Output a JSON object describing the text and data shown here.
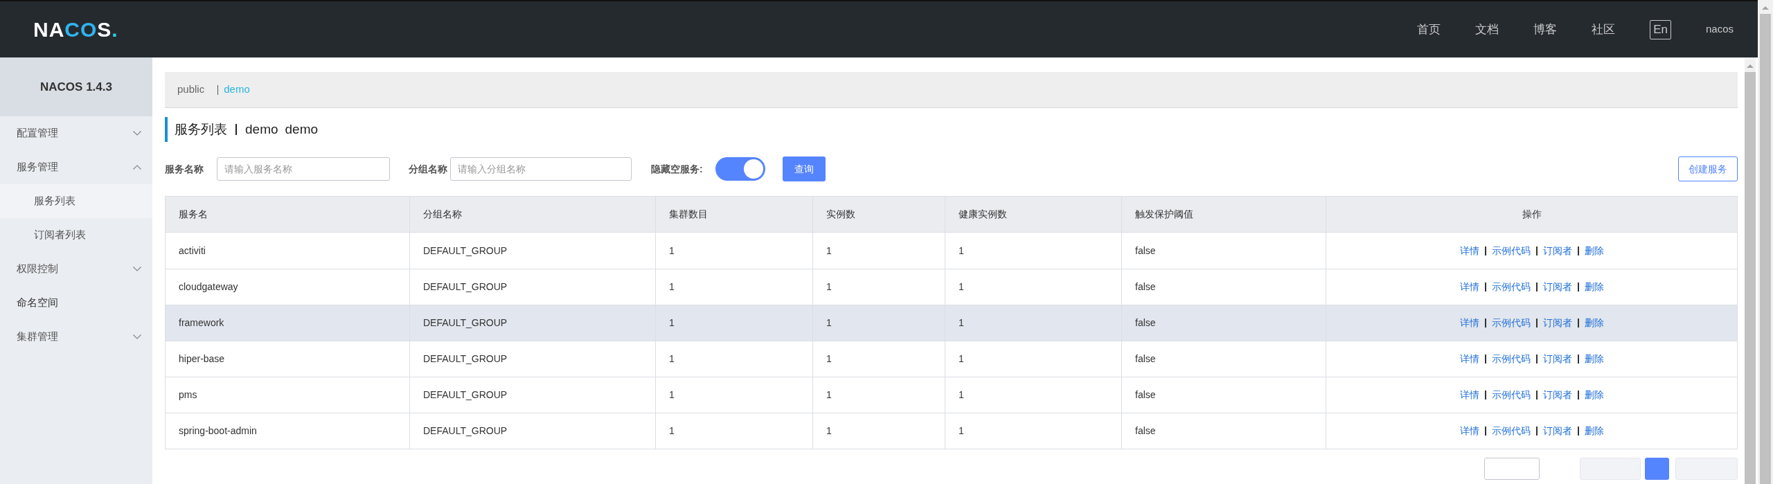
{
  "header": {
    "logo": "NACOS.",
    "nav": [
      "首页",
      "文档",
      "博客",
      "社区"
    ],
    "language": "En",
    "user": "nacos"
  },
  "sidebar": {
    "title": "NACOS 1.4.3",
    "items": [
      {
        "label": "配置管理",
        "kind": "group",
        "expanded": false,
        "selected": false
      },
      {
        "label": "服务管理",
        "kind": "group",
        "expanded": true,
        "selected": false,
        "children": [
          {
            "label": "服务列表",
            "selected": true
          },
          {
            "label": "订阅者列表",
            "selected": false
          }
        ]
      },
      {
        "label": "权限控制",
        "kind": "group",
        "expanded": false,
        "selected": false
      },
      {
        "label": "命名空间",
        "kind": "link",
        "selected": false
      },
      {
        "label": "集群管理",
        "kind": "group",
        "expanded": false,
        "selected": false
      }
    ]
  },
  "namespaces": [
    {
      "label": "public",
      "selected": false
    },
    {
      "label": "demo",
      "selected": true
    }
  ],
  "page_title": {
    "title": "服务列表",
    "namespace": "demo",
    "namespace_id": "demo"
  },
  "filters": {
    "service_label": "服务名称",
    "service_placeholder": "请输入服务名称",
    "group_label": "分组名称",
    "group_placeholder": "请输入分组名称",
    "hide_empty_label": "隐藏空服务:",
    "hide_empty_on": true,
    "query_button": "查询",
    "create_button": "创建服务"
  },
  "table": {
    "columns": [
      "服务名",
      "分组名称",
      "集群数目",
      "实例数",
      "健康实例数",
      "触发保护阈值",
      "操作"
    ],
    "rows": [
      {
        "cells": [
          "activiti",
          "DEFAULT_GROUP",
          "1",
          "1",
          "1",
          "false"
        ],
        "hovered": false,
        "actions": [
          "详情",
          "示例代码",
          "订阅者",
          "删除"
        ]
      },
      {
        "cells": [
          "cloudgateway",
          "DEFAULT_GROUP",
          "1",
          "1",
          "1",
          "false"
        ],
        "hovered": false,
        "actions": [
          "详情",
          "示例代码",
          "订阅者",
          "删除"
        ]
      },
      {
        "cells": [
          "framework",
          "DEFAULT_GROUP",
          "1",
          "1",
          "1",
          "false"
        ],
        "hovered": true,
        "actions": [
          "详情",
          "示例代码",
          "订阅者",
          "删除"
        ]
      },
      {
        "cells": [
          "hiper-base",
          "DEFAULT_GROUP",
          "1",
          "1",
          "1",
          "false"
        ],
        "hovered": false,
        "actions": [
          "详情",
          "示例代码",
          "订阅者",
          "删除"
        ]
      },
      {
        "cells": [
          "pms",
          "DEFAULT_GROUP",
          "1",
          "1",
          "1",
          "false"
        ],
        "hovered": false,
        "actions": [
          "详情",
          "示例代码",
          "订阅者",
          "删除"
        ]
      },
      {
        "cells": [
          "spring-boot-admin",
          "DEFAULT_GROUP",
          "1",
          "1",
          "1",
          "false"
        ],
        "hovered": false,
        "actions": [
          "详情",
          "示例代码",
          "订阅者",
          "删除"
        ]
      }
    ]
  }
}
